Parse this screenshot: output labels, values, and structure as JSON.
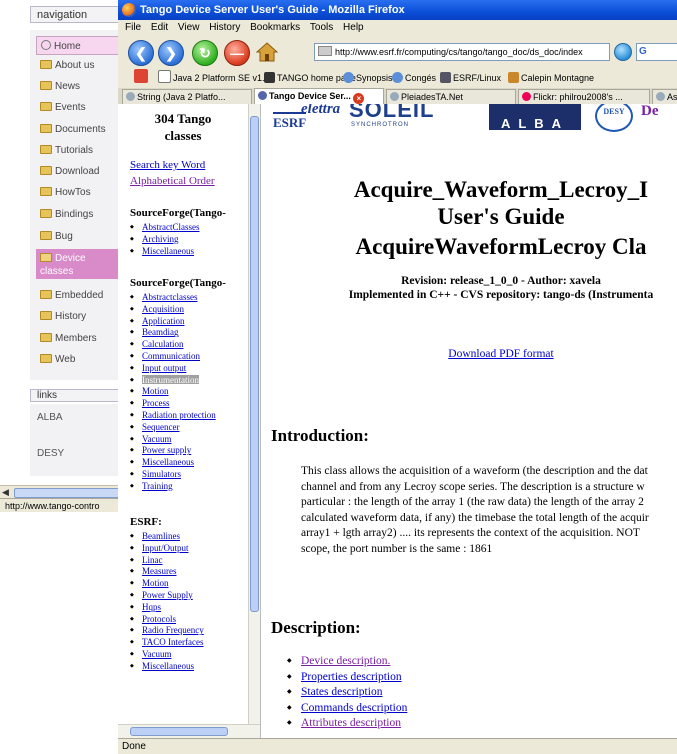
{
  "background_page": {
    "nav_title": "navigation",
    "nav_items": [
      {
        "label": "Home",
        "icon": "home-icon"
      },
      {
        "label": "About us",
        "icon": "folder-icon"
      },
      {
        "label": "News",
        "icon": "folder-icon"
      },
      {
        "label": "Events",
        "icon": "folder-icon"
      },
      {
        "label": "Documents",
        "icon": "folder-icon"
      },
      {
        "label": "Tutorials",
        "icon": "folder-icon"
      },
      {
        "label": "Download",
        "icon": "folder-icon"
      },
      {
        "label": "HowTos",
        "icon": "folder-icon"
      },
      {
        "label": "Bindings",
        "icon": "folder-icon"
      },
      {
        "label": "Bug",
        "icon": "folder-icon"
      },
      {
        "label": "Device classes",
        "icon": "folder-icon"
      },
      {
        "label": "Embedded",
        "icon": "folder-icon"
      },
      {
        "label": "History",
        "icon": "folder-icon"
      },
      {
        "label": "Members",
        "icon": "folder-icon"
      },
      {
        "label": "Web",
        "icon": "folder-icon"
      }
    ],
    "links_title": "links",
    "links": [
      "ALBA",
      "DESY"
    ],
    "status_url": "http://www.tango-contro"
  },
  "window": {
    "title": "Tango Device Server User's Guide - Mozilla Firefox",
    "menu": [
      "File",
      "Edit",
      "View",
      "History",
      "Bookmarks",
      "Tools",
      "Help"
    ],
    "url": "http://www.esrf.fr/computing/cs/tango/tango_doc/ds_doc/index",
    "search_text": "G",
    "bookmarks": [
      "Java 2 Platform SE v1...",
      "TANGO home page",
      "Synopsis",
      "Congés",
      "ESRF/Linux",
      "Calepin Montagne"
    ],
    "tabs": [
      {
        "label": "String (Java 2 Platfo...",
        "active": false
      },
      {
        "label": "Tango Device Ser...",
        "active": true
      },
      {
        "label": "PleiadesTA.Net",
        "active": false
      },
      {
        "label": "Flickr: philrou2008's ...",
        "active": false
      },
      {
        "label": "As",
        "active": false
      }
    ],
    "status": "Done"
  },
  "left_frame": {
    "title_line1": "304 Tango",
    "title_line2": "classes",
    "search_link": "Search key Word",
    "alpha_link": "Alphabetical Order",
    "section1_title": "SourceForge(Tango-",
    "section1_items": [
      "AbstractClasses",
      "Archiving",
      "Miscellaneous"
    ],
    "section2_title": "SourceForge(Tango-",
    "section2_items": [
      "Abstractclasses",
      "Acquisition",
      "Application",
      "Beamdiag",
      "Calculation",
      "Communication",
      "Input output",
      "Instrumentation",
      "Motion",
      "Process",
      "Radiation protection",
      "Sequencer",
      "Vacuum",
      "Power supply",
      "Miscellaneous",
      "Simulators",
      "Training"
    ],
    "section2_highlight": "Instrumentation",
    "section3_title": "ESRF:",
    "section3_items": [
      "Beamlines",
      "Input/Output",
      "Linac",
      "Measures",
      "Motion",
      "Power Supply",
      "Hqps",
      "Protocols",
      "Radio Frequency",
      "TACO Interfaces",
      "Vacuum",
      "Miscellaneous"
    ]
  },
  "right_frame": {
    "logos": {
      "esrf": "ESRF",
      "elettra": "elettra",
      "soleil": "SOLEIL",
      "soleil_sub": "SYNCHROTRON",
      "alba": "ALBA",
      "desy": "DESY",
      "partial": "De"
    },
    "title_line1": "Acquire_Waveform_Lecroy_I",
    "title_line2": "User's Guide",
    "class_title": "AcquireWaveformLecroy Cla",
    "revision": "Revision: release_1_0_0 - Author: xavela",
    "implemented": "Implemented in C++ - CVS repository: tango-ds (Instrumenta",
    "pdf_link": "Download PDF format",
    "intro_heading": "Introduction:",
    "intro_lines": [
      "This class allows the acquisition of a waveform (the description and the dat",
      "channel and from any Lecroy scope series. The description is a structure w",
      "particular : the length of the array 1 (the raw data) the length of the array 2",
      "calculated waveform data, if any) the timebase the total length of the acquir",
      "array1 + lgth array2) .... its represents the context of the acquisition. NOT",
      "scope, the port number is the same : 1861"
    ],
    "desc_heading": "Description:",
    "desc_items": [
      "Device description.",
      "Properties description",
      "States description",
      "Commands description",
      "Attributes description"
    ]
  }
}
